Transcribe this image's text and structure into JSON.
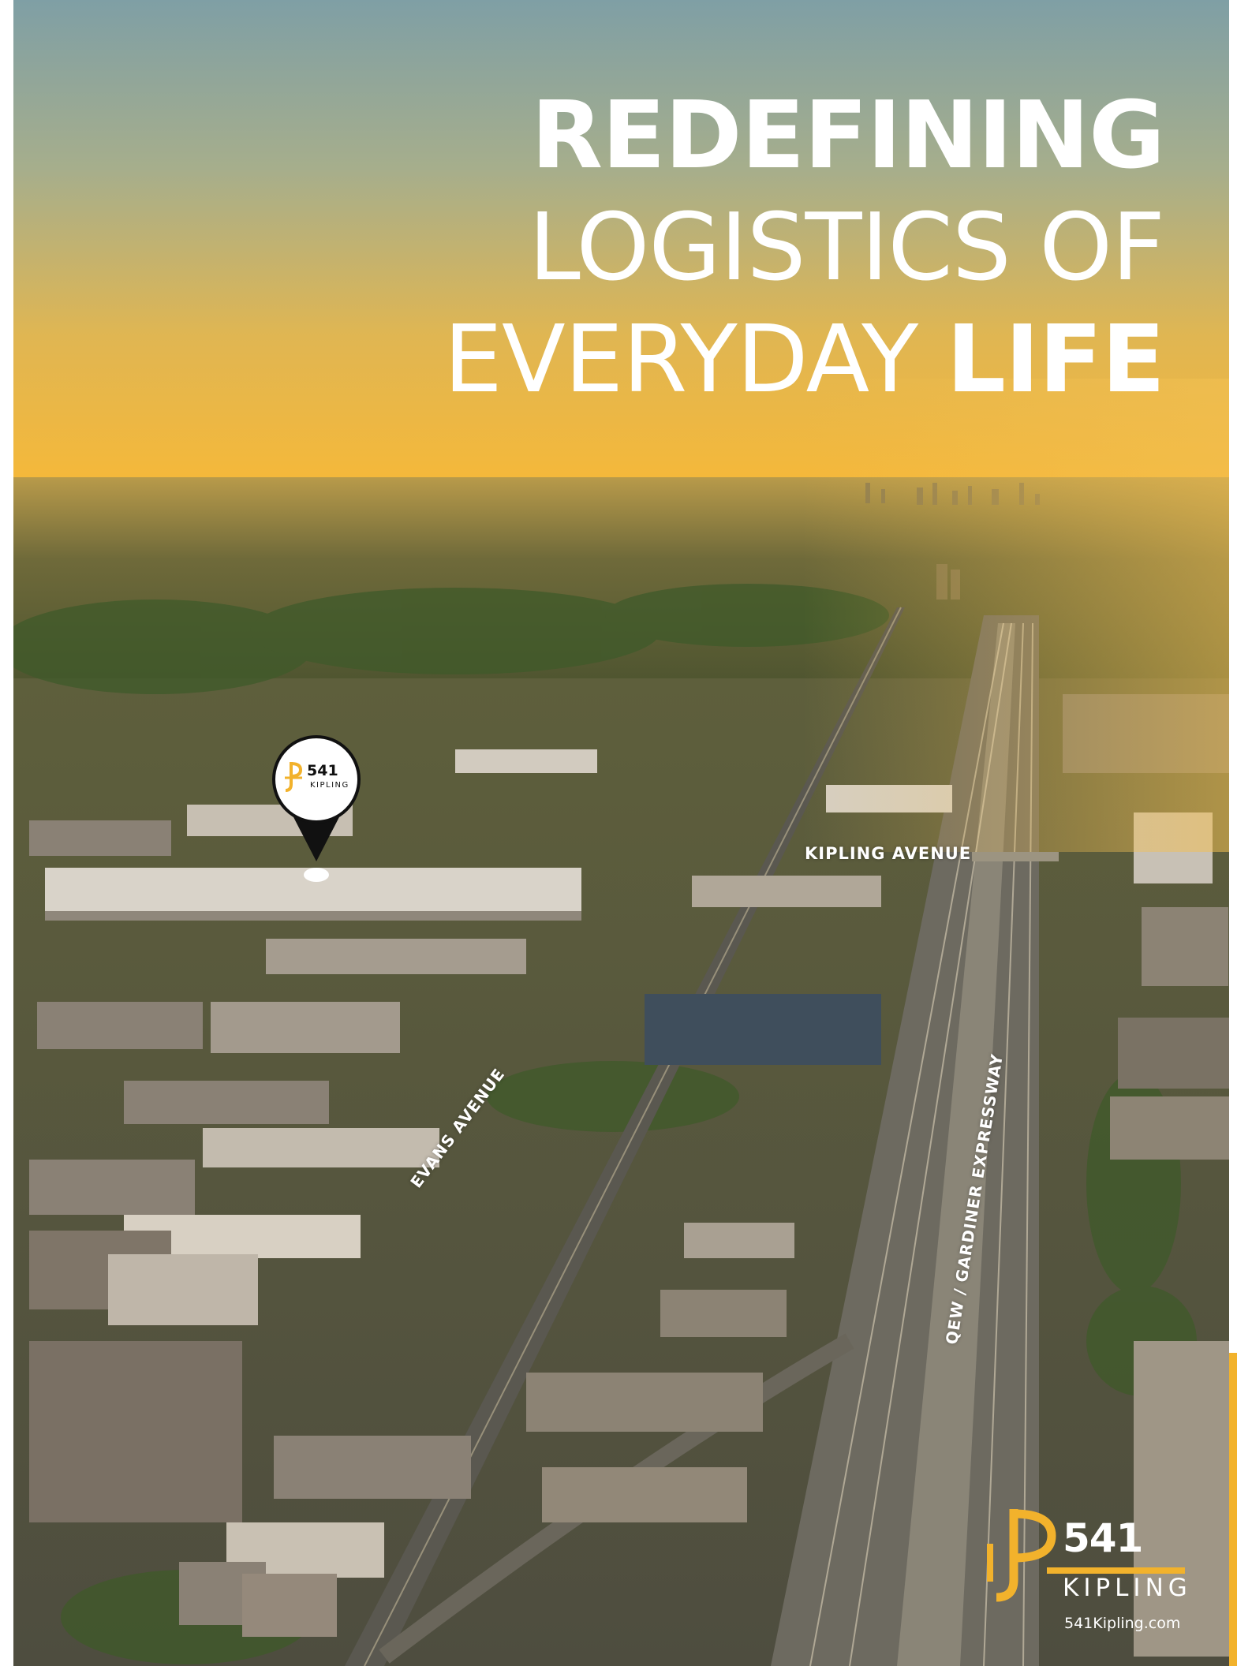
{
  "colors": {
    "accent": "#F2B22C",
    "sky_top": "#7E9FA4",
    "sky_horizon": "#F3B53A",
    "text": "#FFFFFF"
  },
  "headline": {
    "line1_bold": "REDEFINING",
    "line2_light": "LOGISTICS OF",
    "line3_light": "EVERYDAY ",
    "line3_bold": "LIFE"
  },
  "roads": {
    "kipling": "KIPLING AVENUE",
    "evans": "EVANS AVENUE",
    "qew": "QEW / GARDINER EXPRESSWAY"
  },
  "marker": {
    "number": "541",
    "name": "KIPLING",
    "icon": "map-pin-icon"
  },
  "brand": {
    "number": "541",
    "name": "KIPLING",
    "url": "541Kipling.com",
    "icon": "541-kipling-logo-mark"
  }
}
